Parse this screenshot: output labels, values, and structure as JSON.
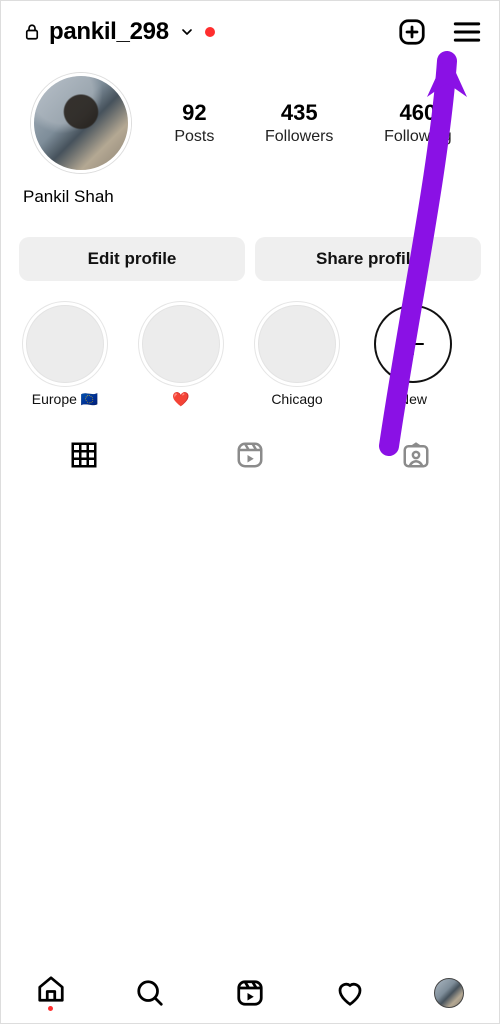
{
  "header": {
    "username": "pankil_298"
  },
  "profile": {
    "display_name": "Pankil Shah",
    "stats": {
      "posts": {
        "value": "92",
        "label": "Posts"
      },
      "followers": {
        "value": "435",
        "label": "Followers"
      },
      "following": {
        "value": "460",
        "label": "Following"
      }
    }
  },
  "buttons": {
    "edit": "Edit profile",
    "share": "Share profile"
  },
  "highlights": [
    {
      "label": "Europe 🇪🇺"
    },
    {
      "label": "❤️"
    },
    {
      "label": "Chicago"
    }
  ],
  "new_highlight_label": "New"
}
